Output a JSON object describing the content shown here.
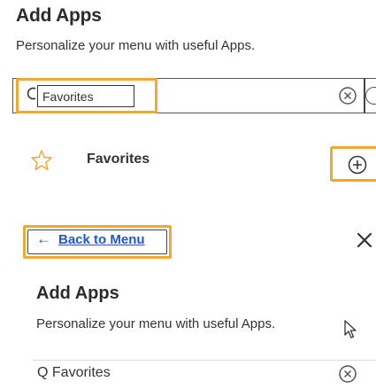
{
  "header": {
    "title": "Add Apps",
    "subtitle": "Personalize your menu with useful Apps."
  },
  "search": {
    "value": "Favorites",
    "icons": {
      "search": "search-icon",
      "clear": "circle-x-icon"
    }
  },
  "favorites_item": {
    "label": "Favorites",
    "icon": "star-outline-icon",
    "action_icon": "circle-plus-icon"
  },
  "navigation": {
    "back_arrow": "←",
    "back_label": "Back to Menu",
    "close_icon": "close-icon"
  },
  "panel": {
    "title": "Add Apps",
    "subtitle": "Personalize your menu with useful Apps.",
    "search_value": "Q Favorites"
  },
  "colors": {
    "highlight": "#f0a830",
    "link": "#2255cc",
    "text": "#333333"
  }
}
